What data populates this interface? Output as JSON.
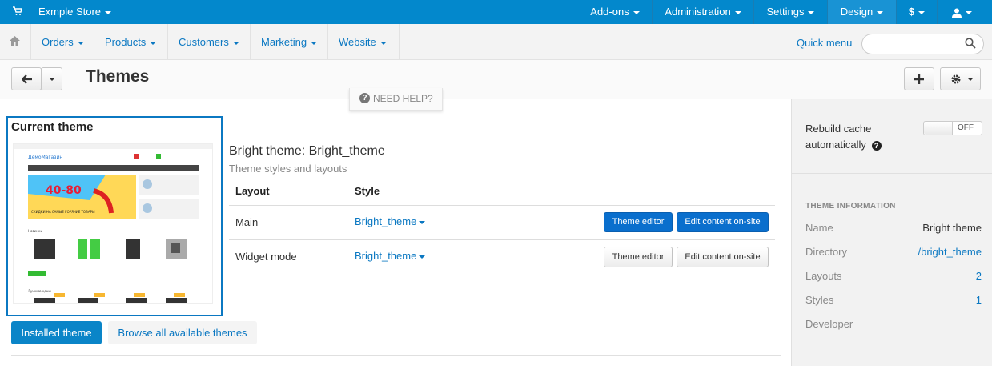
{
  "topbar": {
    "store_name": "Exmple Store",
    "items": [
      {
        "label": "Add-ons"
      },
      {
        "label": "Administration"
      },
      {
        "label": "Settings"
      },
      {
        "label": "Design"
      },
      {
        "label": "$"
      }
    ],
    "cart_icon": "cart-icon",
    "user_icon": "user-icon"
  },
  "navbar": {
    "home_icon": "home-icon",
    "items": [
      {
        "label": "Orders"
      },
      {
        "label": "Products"
      },
      {
        "label": "Customers"
      },
      {
        "label": "Marketing"
      },
      {
        "label": "Website"
      }
    ],
    "quick_menu": "Quick menu",
    "search_placeholder": ""
  },
  "header": {
    "title": "Themes",
    "back_icon": "arrow-left-icon",
    "add_icon": "plus-icon",
    "settings_icon": "gear-icon"
  },
  "help": {
    "label": "NEED HELP?"
  },
  "current_theme": {
    "heading": "Current theme",
    "thumbnail_text": {
      "logo": "ДемоМагазин",
      "banner_big": "40-80",
      "banner_caption": "СКИДКИ НА САМЫЕ ГОРЯЧИЕ ТОВАРЫ",
      "section1": "Новинки",
      "section2": "Лучшие цены"
    },
    "name_line": "Bright theme: Bright_theme",
    "subtitle": "Theme styles and layouts",
    "table": {
      "headers": [
        "Layout",
        "Style"
      ],
      "rows": [
        {
          "layout": "Main",
          "style": "Bright_theme",
          "editor_btn": "Theme editor",
          "content_btn": "Edit content on-site"
        },
        {
          "layout": "Widget mode",
          "style": "Bright_theme",
          "editor_btn": "Theme editor",
          "content_btn": "Edit content on-site"
        }
      ]
    }
  },
  "tabs": {
    "installed": "Installed theme",
    "browse": "Browse all available themes"
  },
  "sidebar": {
    "rebuild_cache": "Rebuild cache automatically",
    "toggle_state": "OFF",
    "info_heading": "THEME INFORMATION",
    "info": [
      {
        "key": "Name",
        "value": "Bright theme"
      },
      {
        "key": "Directory",
        "value": "/bright_theme"
      },
      {
        "key": "Layouts",
        "value": "2"
      },
      {
        "key": "Styles",
        "value": "1"
      },
      {
        "key": "Developer",
        "value": ""
      }
    ]
  },
  "colors": {
    "topbar": "#0388cc",
    "link": "#0b78c2",
    "primary_button": "#0a6fcd"
  }
}
